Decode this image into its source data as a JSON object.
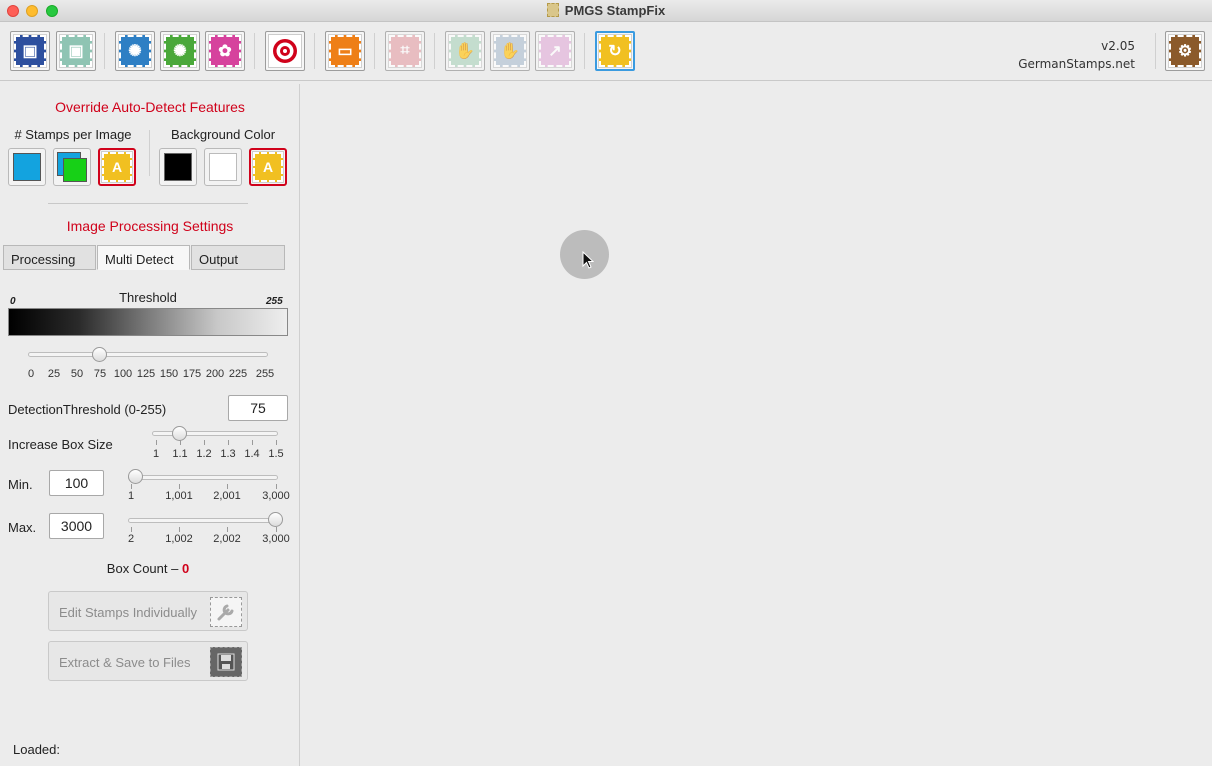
{
  "window": {
    "title": "PMGS StampFix"
  },
  "toolbar": {
    "buttons": [
      {
        "name": "save-icon",
        "color": "#2d4f9e",
        "glyph": "💾"
      },
      {
        "name": "save-as-icon",
        "color": "#8fc4b3",
        "glyph": "⬇"
      },
      {
        "name": "auto-adjust-blue-icon",
        "color": "#2e7fc4",
        "glyph": "✺"
      },
      {
        "name": "auto-adjust-green-icon",
        "color": "#4aa83a",
        "glyph": "✺"
      },
      {
        "name": "settings-pink-icon",
        "color": "#d6429d",
        "glyph": "✿"
      },
      {
        "name": "target-icon",
        "color": "#ffffff",
        "glyph": "◎"
      },
      {
        "name": "monitor-icon",
        "color": "#ee7f17",
        "glyph": "▭"
      },
      {
        "name": "crop-icon",
        "color": "#e7aeb3",
        "glyph": "⌗"
      },
      {
        "name": "hand-icon",
        "color": "#b7d8c5",
        "glyph": "✋"
      },
      {
        "name": "hand-add-icon",
        "color": "#b8c7d6",
        "glyph": "✋"
      },
      {
        "name": "export-icon",
        "color": "#e5b9dc",
        "glyph": "↗"
      },
      {
        "name": "refresh-icon",
        "color": "#f1c021",
        "glyph": "↻"
      }
    ],
    "version": "v2.05",
    "site": "GermanStamps.net",
    "prefs_icon": {
      "color": "#8b5a2b",
      "glyph": "⚙"
    }
  },
  "sidebar": {
    "override_heading": "Override Auto-Detect Features",
    "stamps_label": "# Stamps per Image",
    "background_label": "Background Color",
    "stamps_options": [
      "single-stamp",
      "multi-stamp",
      "auto"
    ],
    "background_options": [
      "black",
      "white",
      "auto"
    ],
    "auto_glyph": "A",
    "processing_heading": "Image Processing Settings",
    "tabs": [
      "Processing",
      "Multi Detect",
      "Output"
    ],
    "selected_tab": "Multi Detect",
    "threshold": {
      "label": "Threshold",
      "min_label": "0",
      "max_label": "255",
      "value": 75,
      "ticks": [
        "0",
        "25",
        "50",
        "75",
        "100",
        "125",
        "150",
        "175",
        "200",
        "225",
        "255"
      ]
    },
    "detection": {
      "label": "DetectionThreshold (0-255)",
      "value": "75"
    },
    "box_size": {
      "label": "Increase Box Size",
      "value": 1.1,
      "ticks": [
        "1",
        "1.1",
        "1.2",
        "1.3",
        "1.4",
        "1.5"
      ]
    },
    "min": {
      "label": "Min.",
      "value": "100",
      "ticks": [
        "1",
        "1,001",
        "2,001",
        "3,000"
      ]
    },
    "max": {
      "label": "Max.",
      "value": "3000",
      "ticks": [
        "2",
        "1,002",
        "2,002",
        "3,000"
      ]
    },
    "box_count_label": "Box Count –",
    "box_count": "0",
    "edit_button": "Edit Stamps Individually",
    "extract_button": "Extract & Save to Files"
  },
  "status": {
    "label": "Loaded:"
  }
}
